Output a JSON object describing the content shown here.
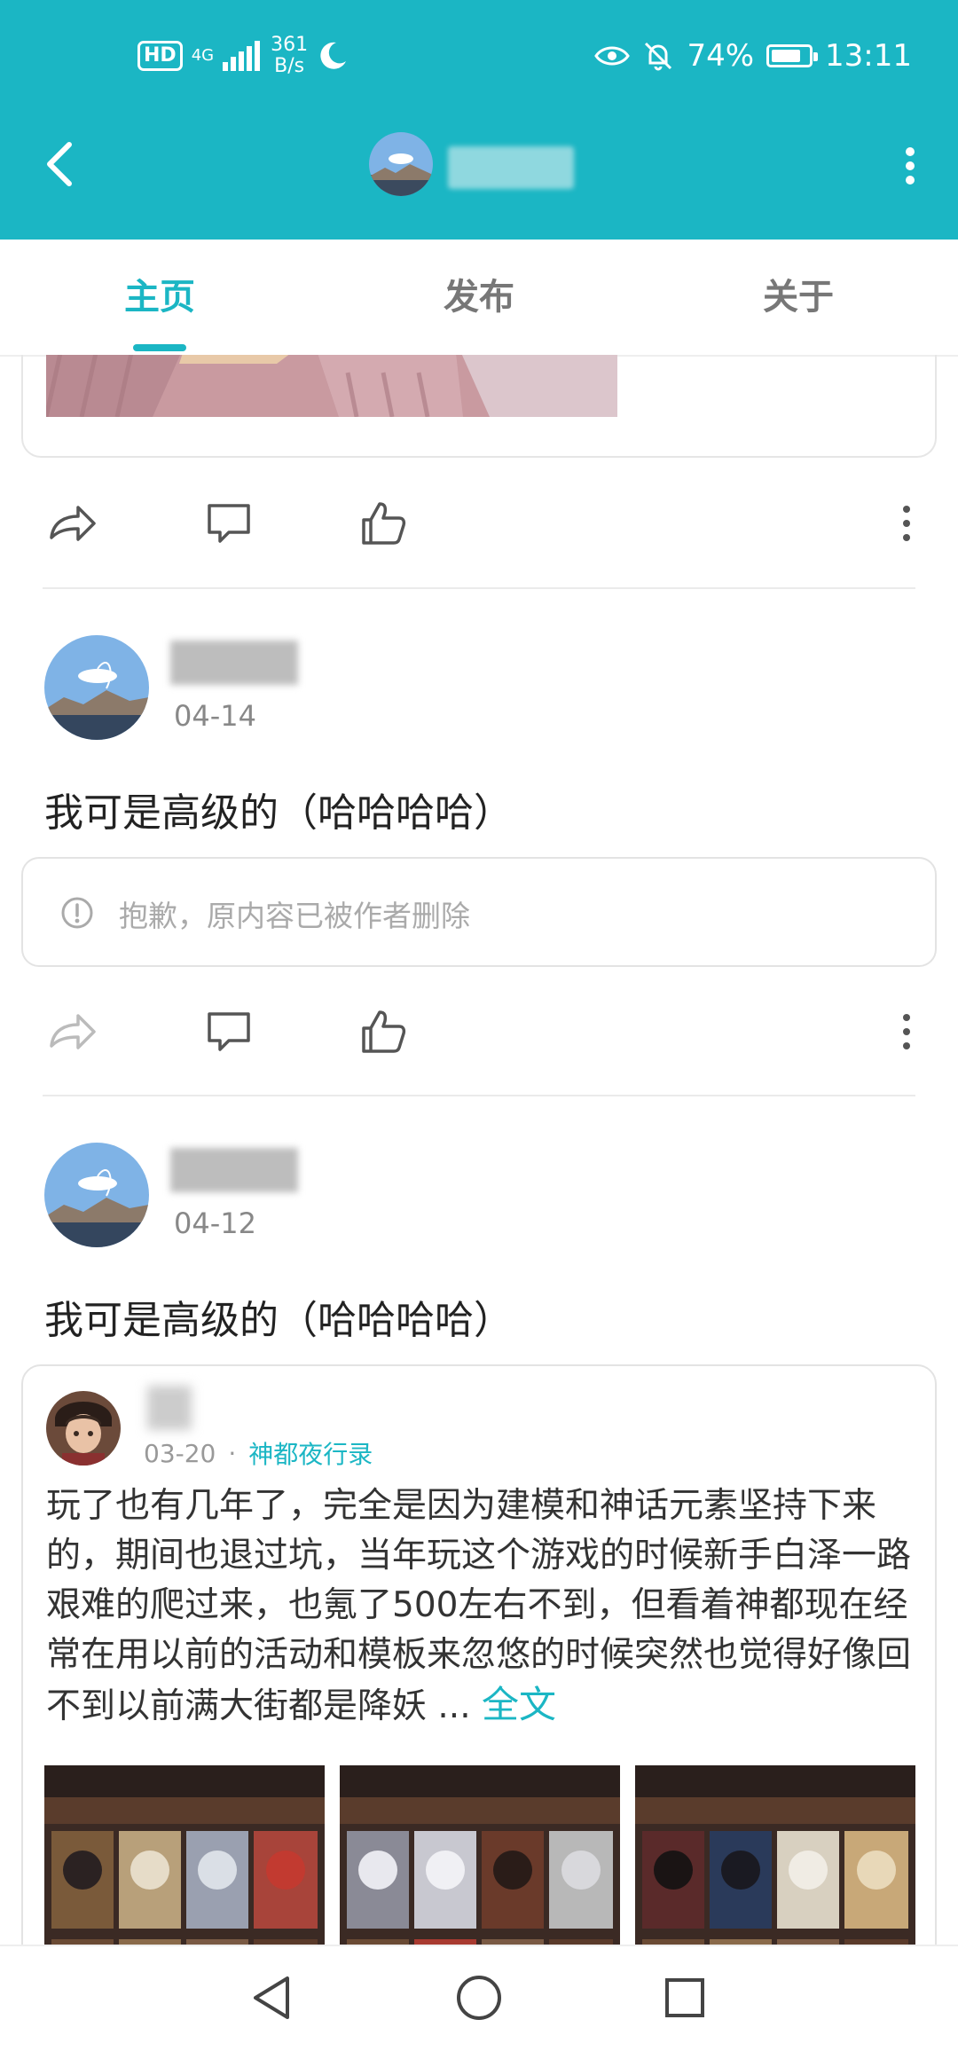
{
  "status_bar": {
    "hd": "HD",
    "network": "4G",
    "speed_value": "361",
    "speed_unit": "B/s",
    "battery": "74%",
    "time": "13:11"
  },
  "tabs": [
    {
      "label": "主页",
      "active": true
    },
    {
      "label": "发布",
      "active": false
    },
    {
      "label": "关于",
      "active": false
    }
  ],
  "posts": [
    {
      "date": "04-14",
      "text": "我可是高级的（哈哈哈哈）",
      "deleted_notice": "抱歉，原内容已被作者删除"
    },
    {
      "date": "04-12",
      "text": "我可是高级的（哈哈哈哈）",
      "repost": {
        "date": "03-20",
        "separator": "·",
        "topic": "神都夜行录",
        "body": "玩了也有几年了，完全是因为建模和神话元素坚持下来的，期间也退过坑，当年玩这个游戏的时候新手白泽一路艰难的爬过来，也氪了500左右不到，但看着神都现在经常在用以前的活动和模板来忽悠的时候突然也觉得好像回不到以前满大街都是降妖",
        "ellipsis": " ...",
        "more_label": "全文"
      }
    }
  ],
  "colors": {
    "brand": "#1bb6c4"
  },
  "icons": [
    "back-icon",
    "more-vertical-icon",
    "share-icon",
    "comment-icon",
    "like-icon",
    "info-icon",
    "nav-back-icon",
    "nav-home-icon",
    "nav-recent-icon"
  ]
}
